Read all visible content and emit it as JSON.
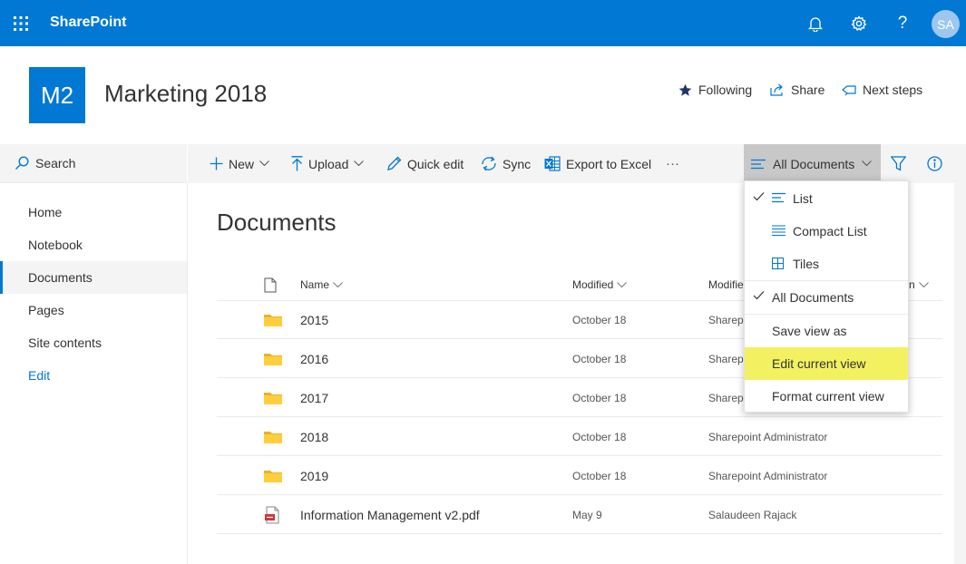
{
  "suite": {
    "title": "SharePoint",
    "avatar_initials": "SA",
    "brand_color": "#0078d4",
    "icons": [
      "waffle-icon",
      "bell-icon",
      "gear-icon",
      "help-icon"
    ]
  },
  "site": {
    "logo_text": "M2",
    "title": "Marketing 2018",
    "actions": {
      "following": "Following",
      "share": "Share",
      "next_steps": "Next steps"
    }
  },
  "search": {
    "label": "Search"
  },
  "nav": {
    "items": [
      {
        "label": "Home"
      },
      {
        "label": "Notebook"
      },
      {
        "label": "Documents"
      },
      {
        "label": "Pages"
      },
      {
        "label": "Site contents"
      },
      {
        "label": "Edit"
      }
    ],
    "selected": "Documents"
  },
  "commands": {
    "new": "New",
    "upload": "Upload",
    "quick_edit": "Quick edit",
    "sync": "Sync",
    "export": "Export to Excel",
    "more": "···",
    "view": "All Documents"
  },
  "library": {
    "title": "Documents",
    "columns": {
      "name": "Name",
      "modified": "Modified",
      "modified_by": "Modifie",
      "add_column": "n"
    },
    "rows": [
      {
        "type": "folder",
        "name": "2015",
        "modified": "October 18",
        "modified_by": "Sharepo"
      },
      {
        "type": "folder",
        "name": "2016",
        "modified": "October 18",
        "modified_by": "Sharepo"
      },
      {
        "type": "folder",
        "name": "2017",
        "modified": "October 18",
        "modified_by": "Sharepo"
      },
      {
        "type": "folder",
        "name": "2018",
        "modified": "October 18",
        "modified_by": "Sharepoint Administrator"
      },
      {
        "type": "folder",
        "name": "2019",
        "modified": "October 18",
        "modified_by": "Sharepoint Administrator"
      },
      {
        "type": "pdf",
        "name": "Information Management v2.pdf",
        "modified": "May 9",
        "modified_by": "Salaudeen Rajack"
      }
    ]
  },
  "view_menu": {
    "items": [
      {
        "label": "List",
        "checked": true,
        "icon": "list-icon"
      },
      {
        "label": "Compact List",
        "checked": false,
        "icon": "compact-list-icon"
      },
      {
        "label": "Tiles",
        "checked": false,
        "icon": "tiles-icon"
      },
      {
        "label": "All Documents",
        "checked": true
      },
      {
        "label": "Save view as"
      },
      {
        "label": "Edit current view",
        "highlighted": true
      },
      {
        "label": "Format current view"
      }
    ],
    "highlight_color": "#f3f160"
  }
}
